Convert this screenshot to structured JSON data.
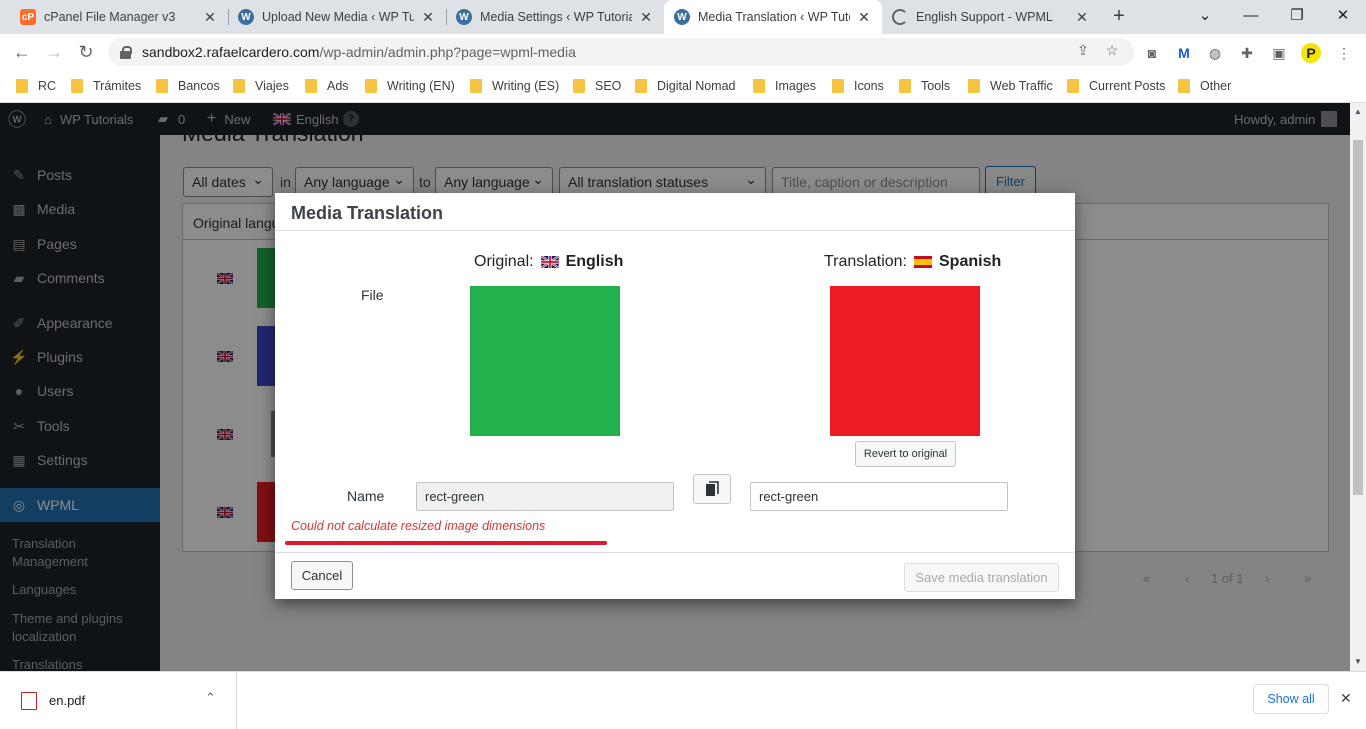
{
  "browser": {
    "tabs": [
      {
        "title": "cPanel File Manager v3",
        "icon": "cpanel-icon"
      },
      {
        "title": "Upload New Media ‹ WP Tuto",
        "icon": "wordpress-icon"
      },
      {
        "title": "Media Settings ‹ WP Tutorials",
        "icon": "wordpress-icon"
      },
      {
        "title": "Media Translation ‹ WP Tuto",
        "icon": "wordpress-icon"
      },
      {
        "title": "English Support - WPML",
        "icon": "loading-icon"
      }
    ],
    "address": {
      "host": "sandbox2.rafaelcardero.com",
      "path": "/wp-admin/admin.php?page=wpml-media"
    },
    "bookmarks": [
      "RC",
      "Trámites",
      "Bancos",
      "Viajes",
      "Ads",
      "Writing (EN)",
      "Writing (ES)",
      "SEO",
      "Digital Nomad",
      "Images",
      "Icons",
      "Tools",
      "Web Traffic",
      "Current Posts",
      "Other"
    ]
  },
  "adminbar": {
    "site_name": "WP Tutorials",
    "comments_count": "0",
    "new_label": "New",
    "language": "English",
    "howdy": "Howdy, admin"
  },
  "sidebar": {
    "items": [
      {
        "label": "Posts",
        "icon": "pin-icon"
      },
      {
        "label": "Media",
        "icon": "media-icon"
      },
      {
        "label": "Pages",
        "icon": "pages-icon"
      },
      {
        "label": "Comments",
        "icon": "comment-icon"
      },
      {
        "label": "Appearance",
        "icon": "brush-icon"
      },
      {
        "label": "Plugins",
        "icon": "plugin-icon"
      },
      {
        "label": "Users",
        "icon": "user-icon"
      },
      {
        "label": "Tools",
        "icon": "wrench-icon"
      },
      {
        "label": "Settings",
        "icon": "settings-icon"
      },
      {
        "label": "WPML",
        "icon": "wpml-icon"
      }
    ],
    "submenu": [
      "Translation Management",
      "Languages",
      "Theme and plugins localization",
      "Translations"
    ]
  },
  "page": {
    "title": "Media Translation",
    "filters": {
      "dates": "All dates",
      "in_word": "in",
      "from_lang": "Any language",
      "to_word": "to",
      "to_lang": "Any language",
      "statuses": "All translation statuses",
      "search_placeholder": "Title, caption or description",
      "filter_button": "Filter"
    },
    "table_header": "Original language",
    "pagination": {
      "first": "«",
      "prev": "‹",
      "info": "1 of 1",
      "next": "›",
      "last": "»"
    }
  },
  "modal": {
    "title": "Media Translation",
    "original_label": "Original:",
    "original_language": "English",
    "translation_label": "Translation:",
    "translation_language": "Spanish",
    "file_label": "File",
    "revert_button": "Revert to original",
    "name_label": "Name",
    "original_name": "rect-green",
    "translated_name": "rect-green",
    "error": "Could not calculate resized image dimensions",
    "cancel_button": "Cancel",
    "save_button": "Save media translation",
    "colors": {
      "original_image": "#22b14c",
      "translated_image": "#ed1c24",
      "error": "#d63638"
    }
  },
  "downloads": {
    "file": "en.pdf",
    "show_all": "Show all"
  }
}
